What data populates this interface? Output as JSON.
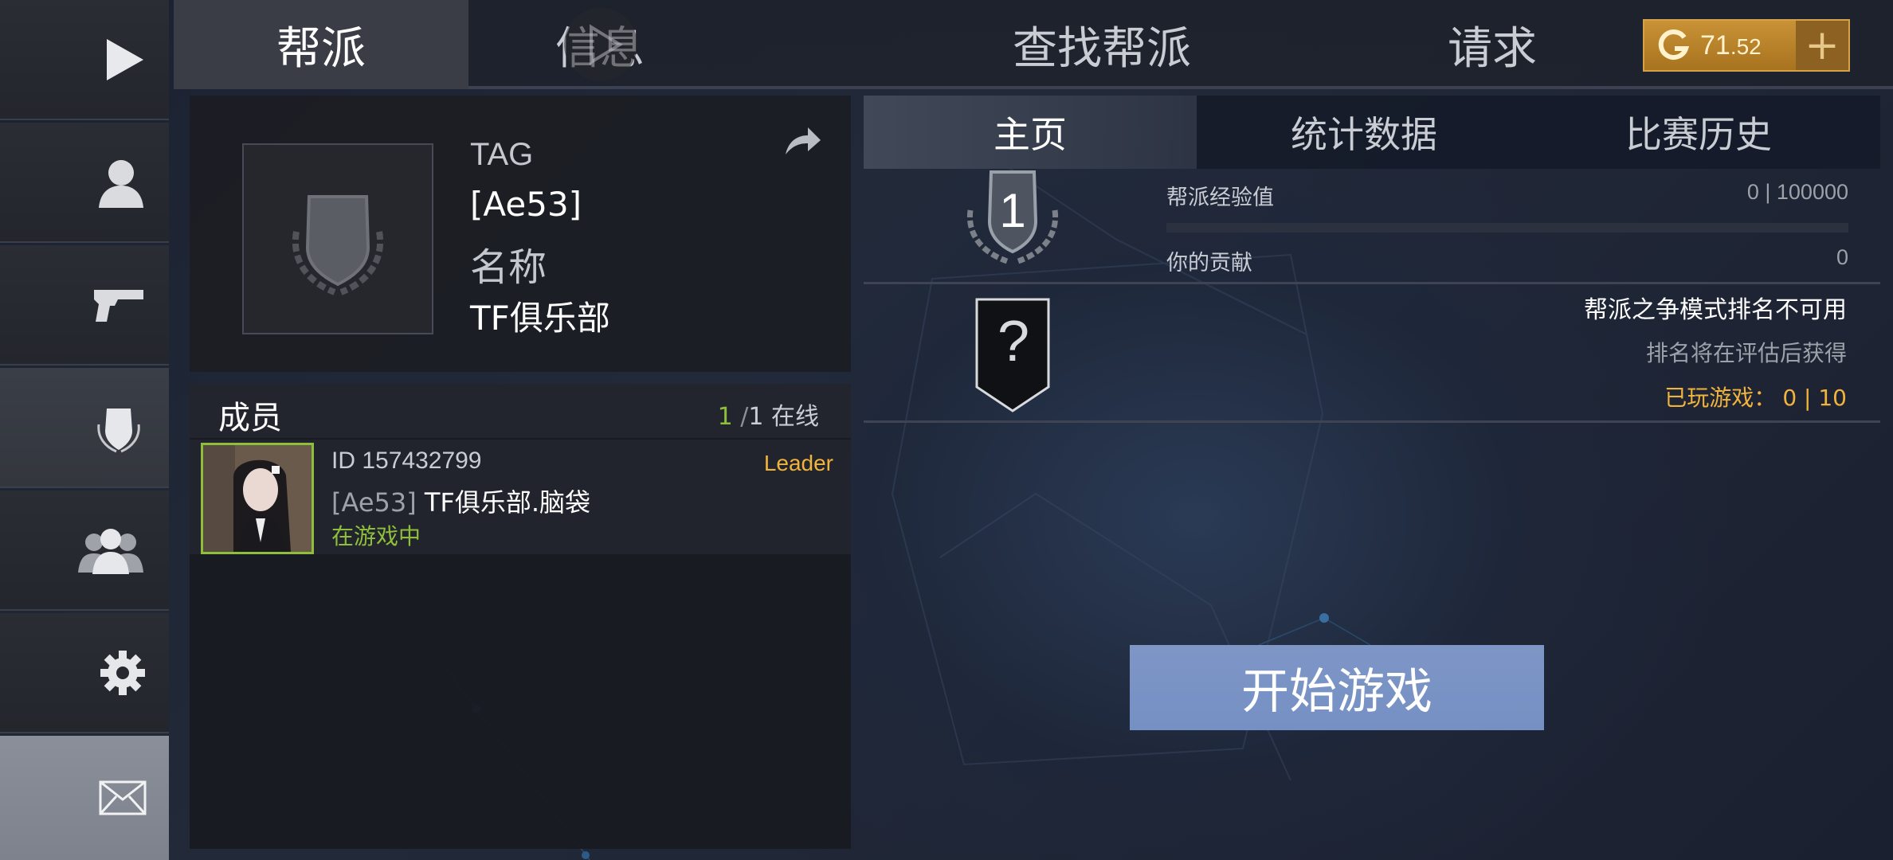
{
  "top_tabs": [
    "帮派",
    "信息",
    "查找帮派",
    "请求"
  ],
  "currency": {
    "value_main": "71",
    "value_decimal": ".52",
    "plus": "+"
  },
  "clan": {
    "tag_label": "TAG",
    "tag_value": "[Ae53]",
    "name_label": "名称",
    "name_value": "TF俱乐部"
  },
  "members": {
    "title": "成员",
    "online_count": "1",
    "online_sep": "/",
    "online_total": "1",
    "online_label": "在线",
    "list": [
      {
        "id": "ID 157432799",
        "tag": "[Ae53]",
        "name": "TF俱乐部.脑袋",
        "status": "在游戏中",
        "role": "Leader"
      }
    ]
  },
  "right_tabs": [
    "主页",
    "统计数据",
    "比赛历史"
  ],
  "clan_stats": {
    "level": "1",
    "exp_label": "帮派经验值",
    "exp_value": "0 | 100000",
    "exp_progress": 0,
    "contribution_label": "你的贡献",
    "contribution_value": "0"
  },
  "ranking": {
    "badge": "?",
    "unavailable": "帮派之争模式排名不可用",
    "note": "排名将在评估后获得",
    "played_label": "已玩游戏：",
    "played_value": "0 | 10"
  },
  "start_button": "开始游戏",
  "colors": {
    "accent_gold": "#f0b33c",
    "online_green": "#8fbf3a",
    "start_blue": "#7590c4"
  }
}
